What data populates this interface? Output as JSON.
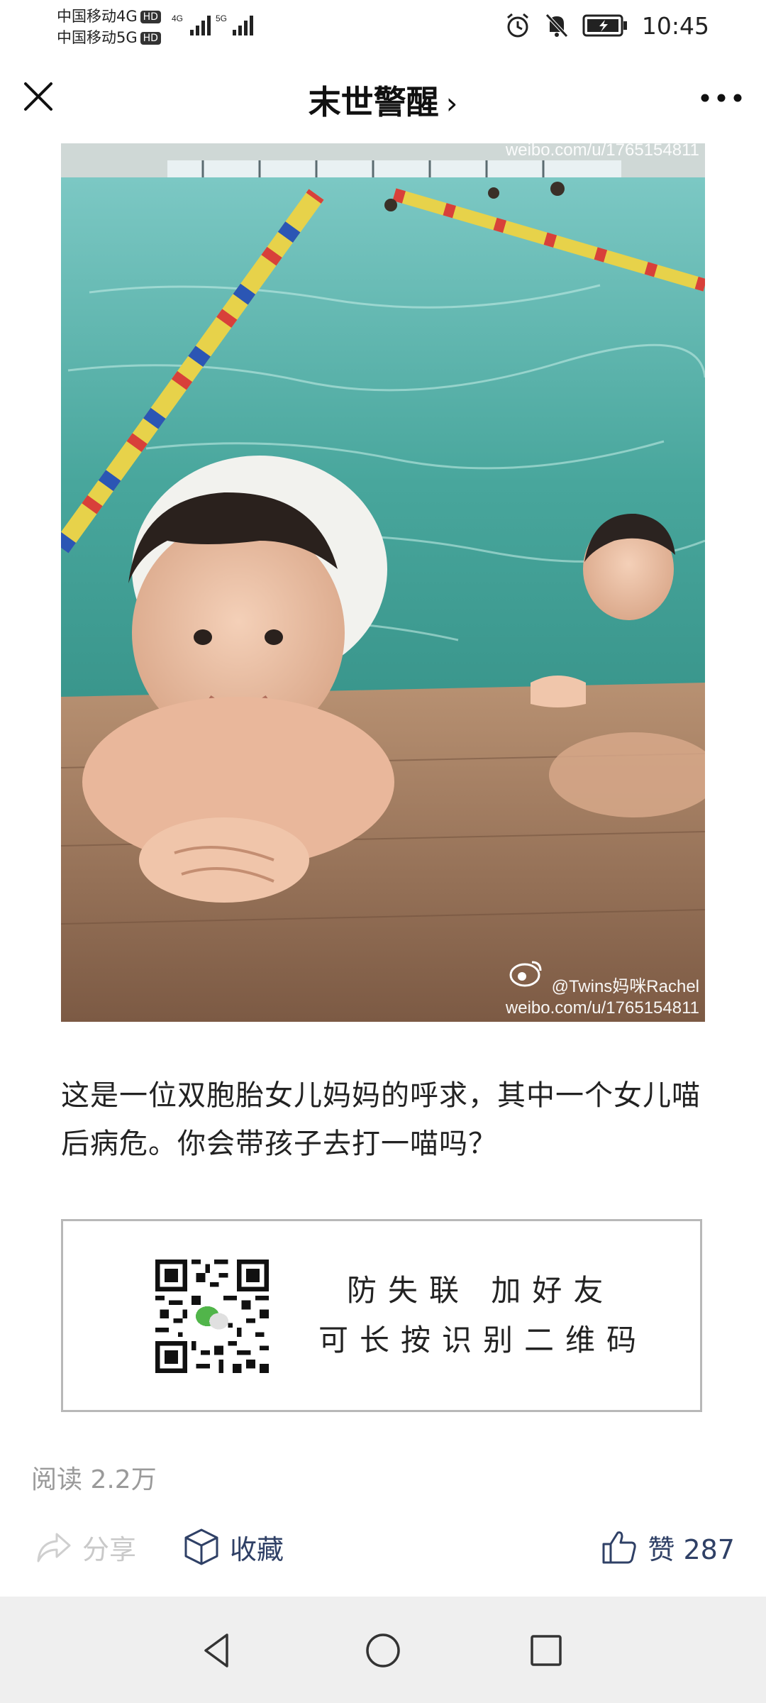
{
  "status": {
    "carrier1": "中国移动4G",
    "carrier2": "中国移动5G",
    "hd": "HD",
    "net1": "4G",
    "net2": "5G",
    "time": "10:45",
    "icons": [
      "alarm-icon",
      "mute-icon",
      "battery-icon"
    ]
  },
  "nav": {
    "title": "末世警醒",
    "chevron": "›",
    "close_icon": "close-icon",
    "more_icon": "more-icon"
  },
  "photo": {
    "watermark_top": "weibo.com/u/1765154811",
    "watermark_handle": "@Twins妈咪Rachel",
    "watermark_bottom": "weibo.com/u/1765154811"
  },
  "article": {
    "text": "这是一位双胞胎女儿妈妈的呼求，其中一个女儿喵后病危。你会带孩子去打一喵吗？"
  },
  "qr": {
    "line1": "防失联 加好友",
    "line2": "可长按识别二维码"
  },
  "stats": {
    "read_label": "阅读 2.2万"
  },
  "actions": {
    "share": "分享",
    "favorite": "收藏",
    "like": "赞 287"
  },
  "colors": {
    "accent": "#2f4066",
    "muted": "#9a9a9a",
    "pool": "#4aa8a0"
  }
}
